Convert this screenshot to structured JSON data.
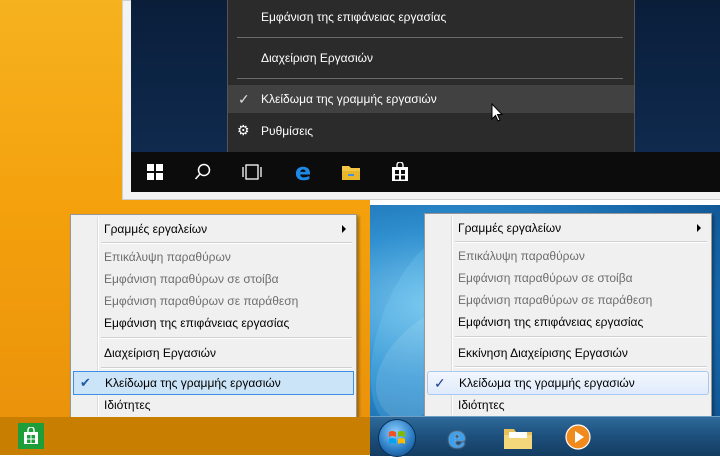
{
  "win10": {
    "menu": {
      "show_desktop": "Εμφάνιση της επιφάνειας εργασίας",
      "task_manager": "Διαχείριση Εργασιών",
      "lock_taskbar": "Κλείδωμα της γραμμής εργασιών",
      "settings": "Ρυθμίσεις"
    },
    "taskbar_icons": [
      "windows-start-icon",
      "search-icon",
      "task-view-icon",
      "edge-icon",
      "file-explorer-icon",
      "store-icon"
    ]
  },
  "win8": {
    "menu": {
      "toolbars": "Γραμμές εργαλείων",
      "cascade": "Επικάλυψη παραθύρων",
      "stacked": "Εμφάνιση παραθύρων σε στοίβα",
      "side_by_side": "Εμφάνιση παραθύρων σε παράθεση",
      "show_desktop": "Εμφάνιση της επιφάνειας εργασίας",
      "task_manager": "Διαχείριση Εργασιών",
      "lock_taskbar": "Κλείδωμα της γραμμής εργασιών",
      "properties": "Ιδιότητες"
    },
    "taskbar_icons": [
      "store-icon"
    ]
  },
  "win7": {
    "menu": {
      "toolbars": "Γραμμές εργαλείων",
      "cascade": "Επικάλυψη παραθύρων",
      "stacked": "Εμφάνιση παραθύρων σε στοίβα",
      "side_by_side": "Εμφάνιση παραθύρων σε παράθεση",
      "show_desktop": "Εμφάνιση της επιφάνειας εργασίας",
      "task_manager": "Εκκίνηση Διαχείρισης Εργασιών",
      "lock_taskbar": "Κλείδωμα της γραμμής εργασιών",
      "properties": "Ιδιότητες"
    },
    "taskbar_icons": [
      "start-orb-icon",
      "internet-explorer-icon",
      "windows-explorer-icon",
      "media-player-icon"
    ]
  },
  "colors": {
    "win8_bg": "#f4a10d",
    "win10_menu_bg": "#2b2b2b",
    "win7_highlight": "#dfeafb",
    "win8_highlight": "#cce4f7"
  }
}
